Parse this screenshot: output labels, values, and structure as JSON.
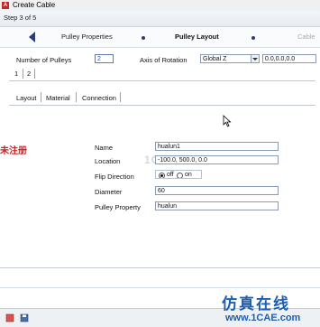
{
  "window": {
    "title": "Create Cable",
    "app_icon_letter": "A"
  },
  "wizard": {
    "step_text": "Step 3 of 5",
    "steps": [
      "Pulley Properties",
      "Pulley Layout",
      "Cable"
    ]
  },
  "form": {
    "num_pulleys_label": "Number of Pulleys",
    "num_pulleys_value": "2",
    "axis_label": "Axis of Rotation",
    "axis_value": "Global Z",
    "axis_vector": "0.0,0.0,0.0",
    "pulley_tabs": [
      "1",
      "2"
    ],
    "section_tabs": [
      "Layout",
      "Material",
      "Connection"
    ],
    "name_label": "Name",
    "name_value": "hualun1",
    "location_label": "Location",
    "location_value": "-100.0, 500.0, 0.0",
    "flip_label": "Flip Direction",
    "flip_off": "off",
    "flip_on": "on",
    "diameter_label": "Diameter",
    "diameter_value": "60",
    "property_label": "Pulley Property",
    "property_value": "hualun"
  },
  "overlay": {
    "side_text": "未注册",
    "watermark": "1CAE.COM",
    "brand_cn": "仿真在线",
    "brand_url": "www.1CAE.com"
  },
  "colors": {
    "accent": "#2c3e7a",
    "brand": "#1a5fb4",
    "warning": "#cc1f1f"
  }
}
